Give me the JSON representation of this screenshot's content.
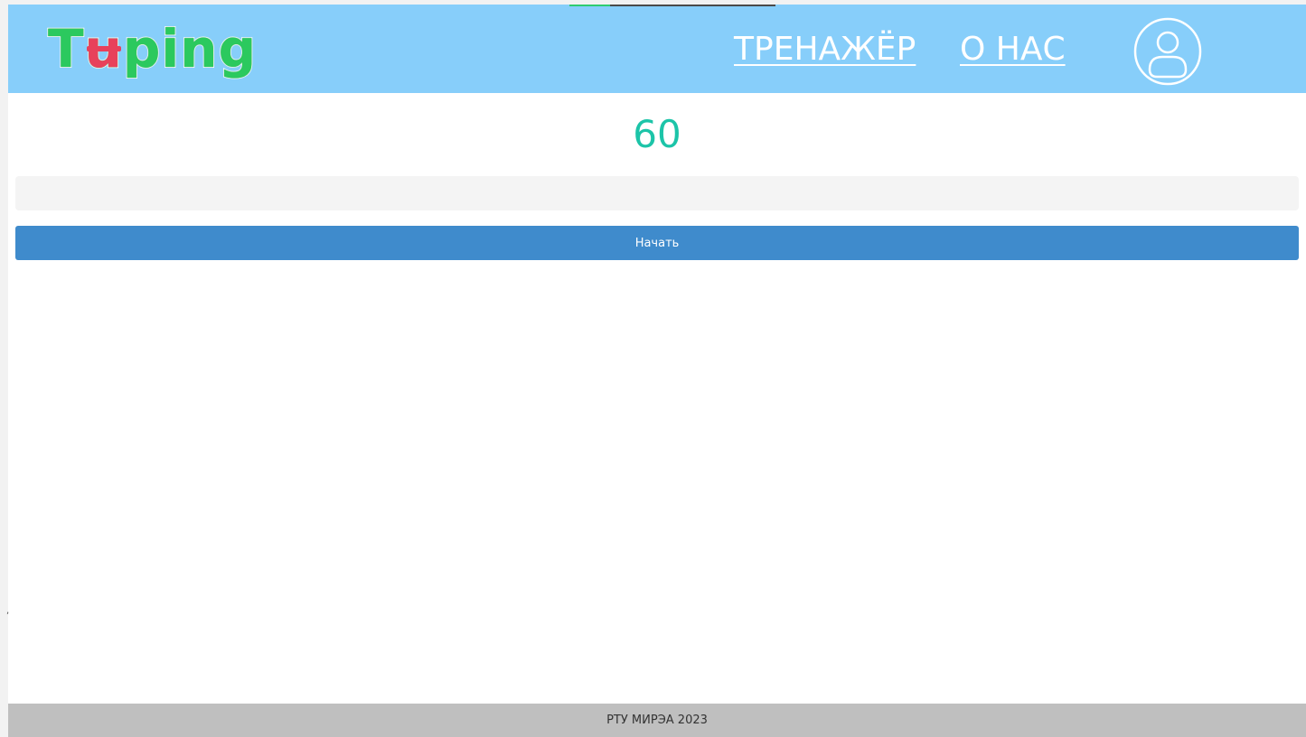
{
  "header": {
    "logo": {
      "part1": "T",
      "part2": "u",
      "part3": "ping"
    },
    "nav": {
      "trainer_label": "ТРЕНАЖЁР",
      "about_label": "О НАС"
    },
    "profile_icon": "user-circle-icon"
  },
  "main": {
    "timer_value": "60",
    "text_input": {
      "value": "",
      "placeholder": ""
    },
    "start_button_label": "Начать"
  },
  "footer": {
    "text": "РТУ МИРЭА 2023"
  },
  "colors": {
    "header_bg": "#87cefa",
    "logo_green": "#2bc95e",
    "logo_red": "#e8415b",
    "timer": "#1cc4a8",
    "button_bg": "#3f8bcc",
    "footer_bg": "#bfbfbf"
  }
}
